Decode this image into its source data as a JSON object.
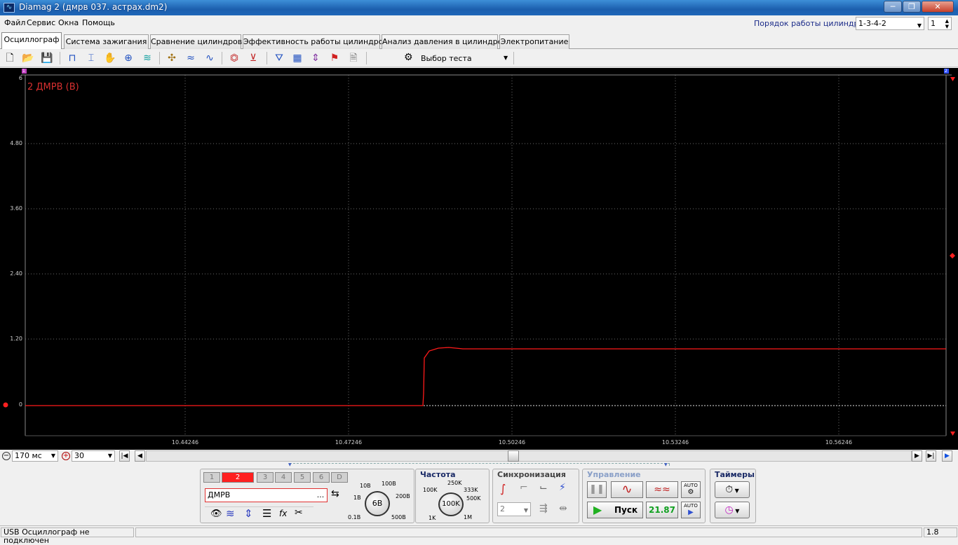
{
  "window": {
    "title": "Diamag 2 (дмрв 037. астрах.dm2)",
    "minimize": "─",
    "maximize": "❐",
    "close": "✕"
  },
  "menu": [
    "Файл",
    "Сервис",
    "Окна",
    "Помощь"
  ],
  "cylinder_order": {
    "label": "Порядок работы цилиндров",
    "value": "1-3-4-2",
    "spinner": "1"
  },
  "tabs": [
    "Осциллограф",
    "Система зажигания",
    "Сравнение цилиндров",
    "Эффективность работы цилиндров",
    "Анализ давления в цилиндре",
    "Электропитание"
  ],
  "toolbar": {
    "test_select": "Выбор теста"
  },
  "scope": {
    "channel_label": "2 ДМРВ (В)",
    "marker_left": "1",
    "marker_right": "2",
    "y_ticks": [
      "6",
      "4.80",
      "3.60",
      "2.40",
      "1.20",
      "0"
    ],
    "x_ticks": [
      "10.44246",
      "10.47246",
      "10.50246",
      "10.53246",
      "10.56246"
    ],
    "trace_color": "#ff1a1a"
  },
  "nav": {
    "timebase": "170 мс",
    "zoom": "30"
  },
  "channels": {
    "buttons": [
      "1",
      "2",
      "3",
      "4",
      "5",
      "6",
      "D"
    ],
    "active": "2",
    "name": "ДМРВ",
    "name_ellipsis": "..."
  },
  "volt_knob": {
    "value": "6В",
    "labels": [
      "10В",
      "100В",
      "1В",
      "200В",
      "0.1В",
      "500В"
    ]
  },
  "freq": {
    "title": "Частота",
    "value": "100K",
    "labels": [
      "250K",
      "100K",
      "333K",
      "500K",
      "1K",
      "1M"
    ]
  },
  "sync": {
    "title": "Синхронизация",
    "channel": "2"
  },
  "control": {
    "title": "Управление",
    "start": "Пуск",
    "value": "21.87",
    "auto": "AUTO"
  },
  "timers": {
    "title": "Таймеры"
  },
  "status": {
    "text": "USB Осциллограф не подключен",
    "version": "1.8"
  }
}
